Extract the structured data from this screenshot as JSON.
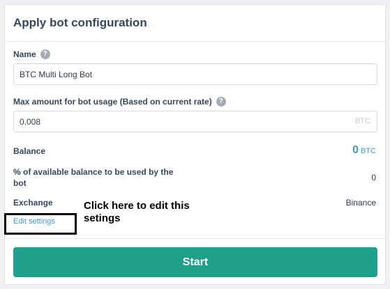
{
  "card": {
    "title": "Apply bot configuration"
  },
  "name_field": {
    "label": "Name",
    "help_icon": "?",
    "value": "BTC Multi Long Bot"
  },
  "max_amount_field": {
    "label": "Max amount for bot usage (Based on current rate)",
    "help_icon": "?",
    "value": "0.008",
    "suffix": "BTC"
  },
  "balance": {
    "label": "Balance",
    "value": "0",
    "unit": "BTC"
  },
  "available_balance": {
    "label_line1": "% of available balance to be used by the",
    "label_line2": "bot",
    "value": "0"
  },
  "exchange": {
    "label": "Exchange",
    "value": "Binance"
  },
  "edit_settings": {
    "label": "Edit settings"
  },
  "annotation": {
    "line1": "Click here to edit this",
    "line2": "setings"
  },
  "start_button": {
    "label": "Start"
  },
  "colors": {
    "accent": "#1fa08a",
    "link": "#3d9ad1",
    "text": "#34495e"
  },
  "icons": {
    "help": "question-circle-icon"
  }
}
